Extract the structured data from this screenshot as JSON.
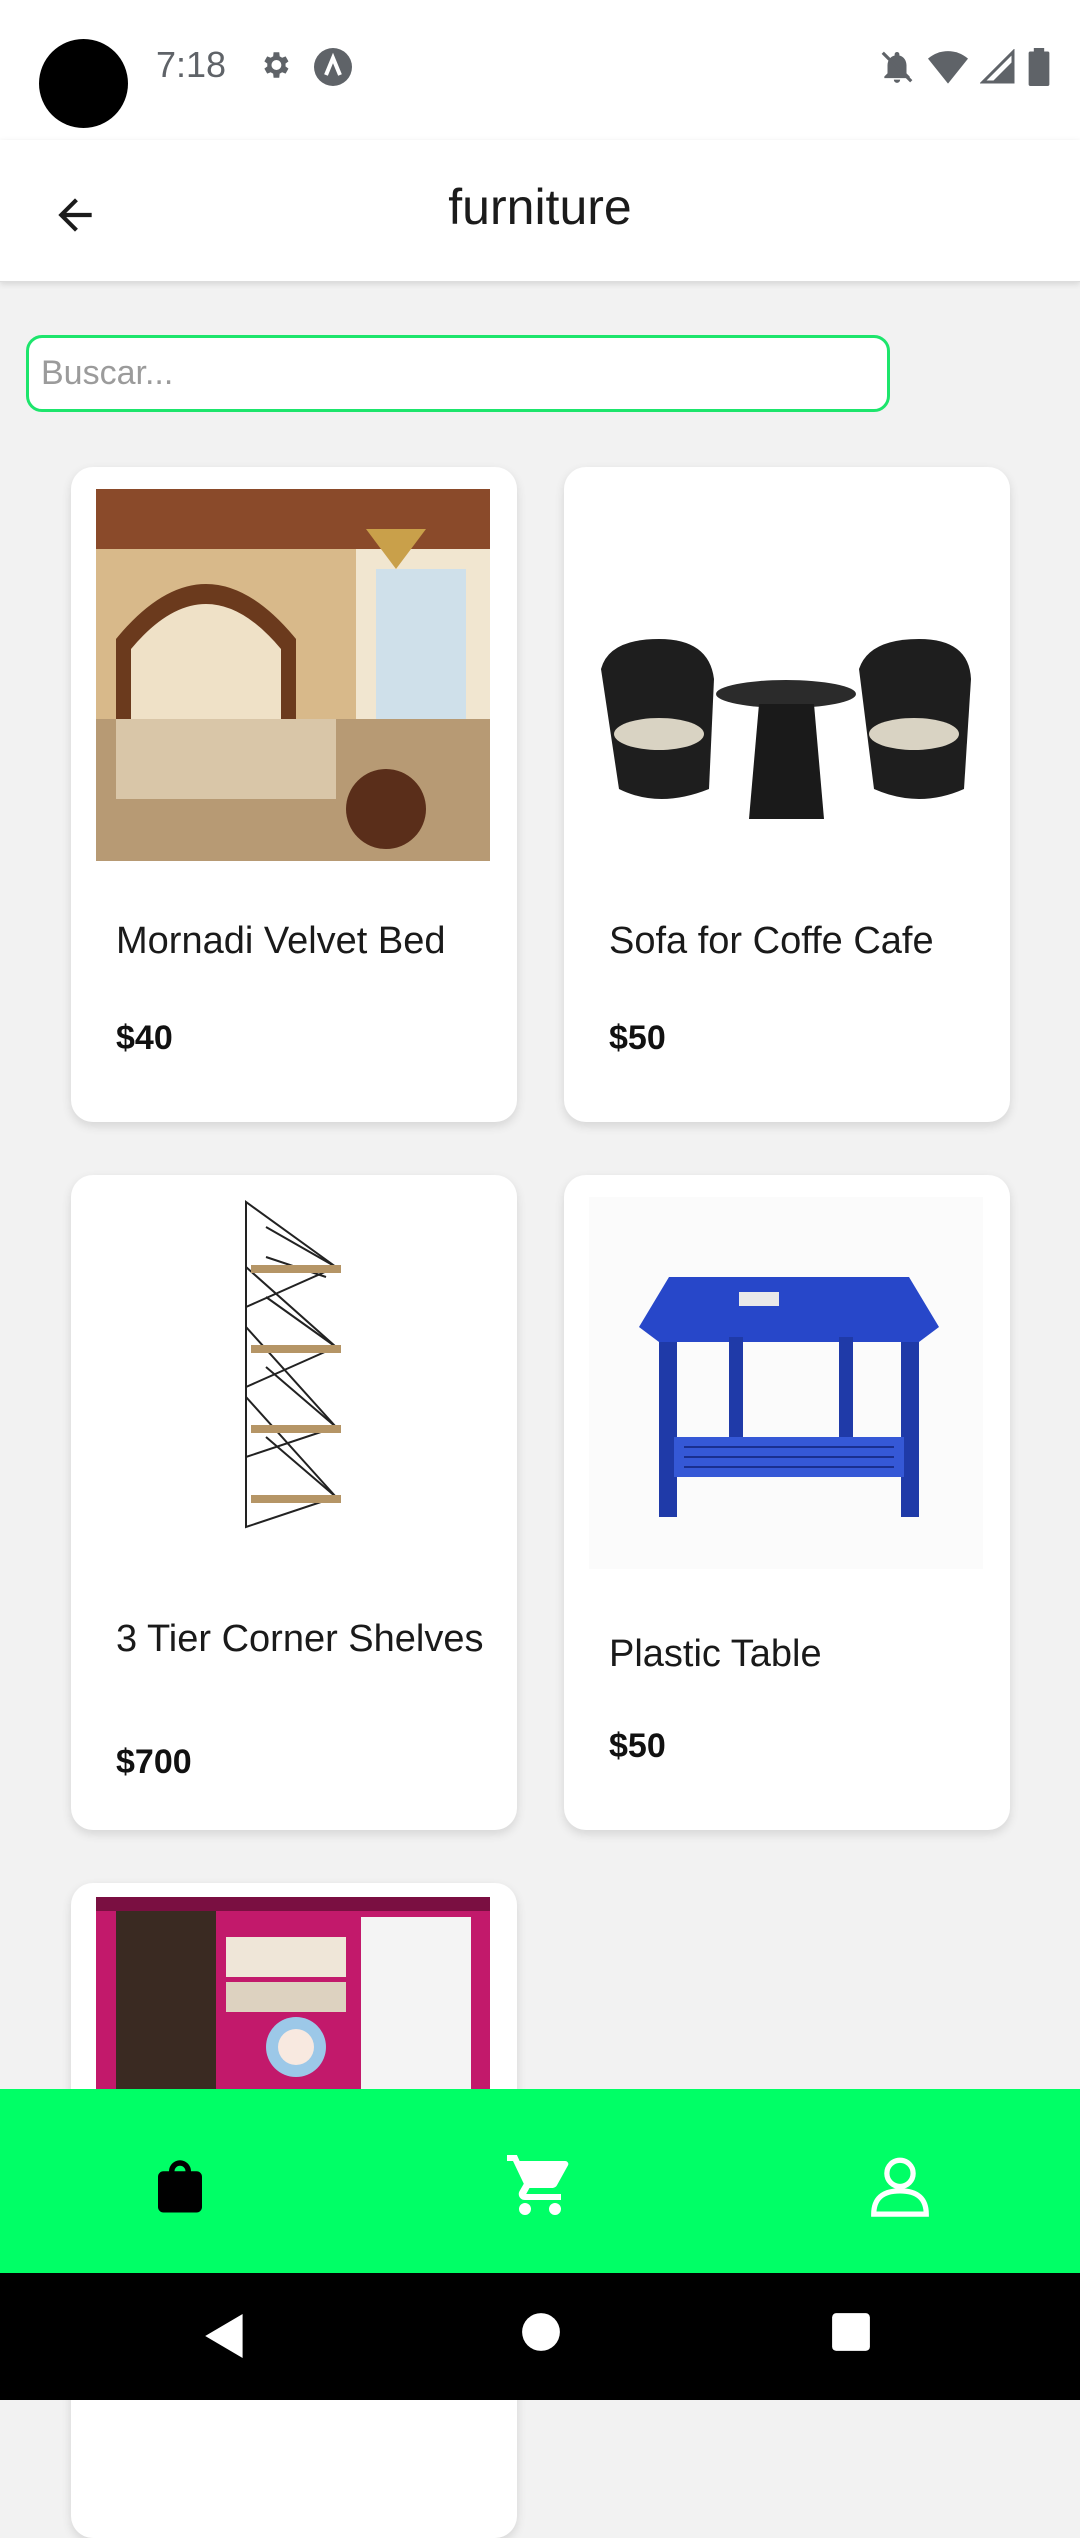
{
  "status_bar": {
    "time": "7:18",
    "icons": [
      "settings-icon",
      "a-icon",
      "notifications-off-icon",
      "wifi-icon",
      "signal-icon",
      "battery-icon"
    ]
  },
  "app_bar": {
    "title": "furniture",
    "back_icon": "arrow-left-icon"
  },
  "search": {
    "placeholder": "Buscar...",
    "value": "",
    "accent": "#1de56c"
  },
  "products": [
    {
      "name": "Mornadi Velvet Bed",
      "price": "$40",
      "image": "bedroom-photo"
    },
    {
      "name": "Sofa for Coffe Cafe",
      "price": "$50",
      "image": "wicker-chairs-photo"
    },
    {
      "name": "3 Tier Corner Shelves",
      "price": "$700",
      "image": "corner-shelves-photo"
    },
    {
      "name": "Plastic Table",
      "price": "$50",
      "image": "blue-table-photo"
    },
    {
      "name": "",
      "price": "",
      "image": "wardrobe-photo"
    }
  ],
  "bottom_nav": {
    "background": "#00ff66",
    "items": [
      "shopping-bag-icon",
      "cart-icon",
      "profile-icon"
    ]
  },
  "system_nav": [
    "back-triangle-icon",
    "home-circle-icon",
    "recents-square-icon"
  ]
}
